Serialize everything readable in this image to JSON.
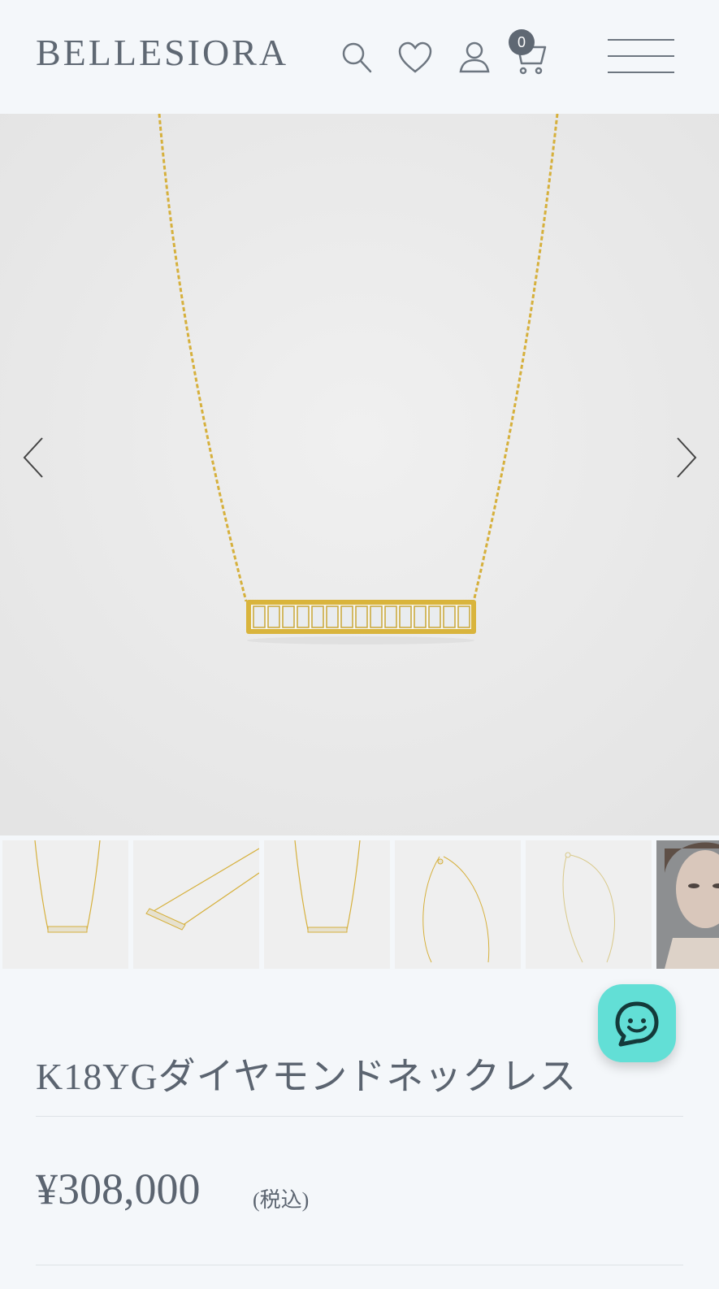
{
  "header": {
    "logo": "BELLESIORA",
    "cart_count": "0"
  },
  "gallery": {
    "thumbnail_count": 6
  },
  "product": {
    "name": "K18YGダイヤモンドネックレス",
    "price": "¥308,000",
    "tax_note": "(税込)"
  },
  "colors": {
    "background": "#f4f7fa",
    "text": "#5b6470",
    "chat_button": "#62dfd6",
    "gold": "#d9b43c"
  }
}
